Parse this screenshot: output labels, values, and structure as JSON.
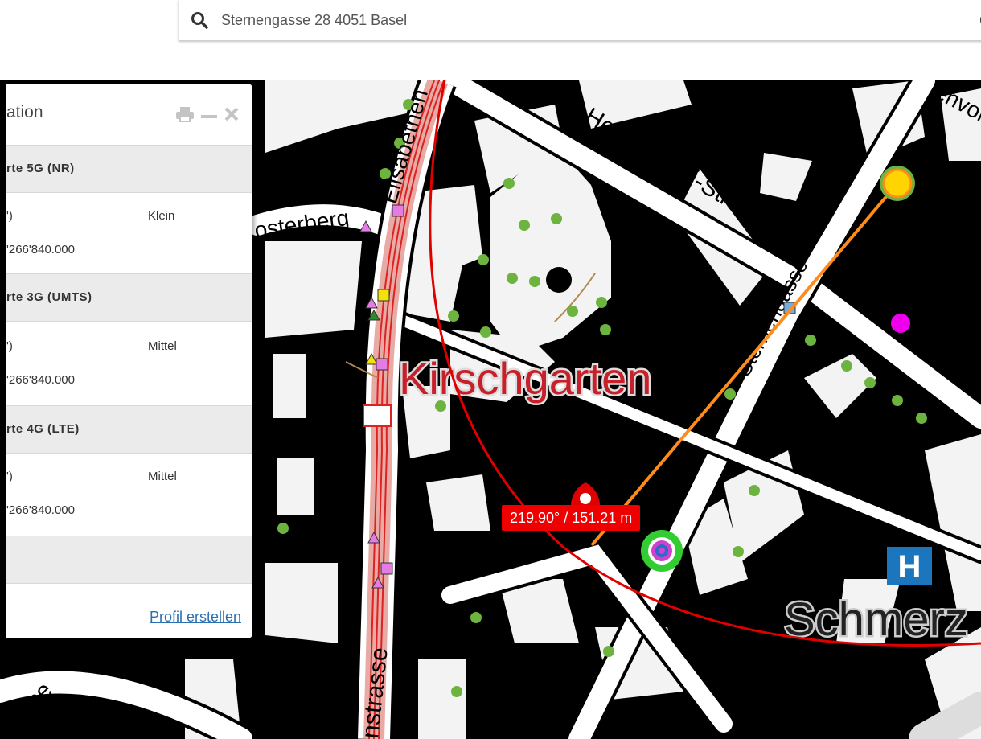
{
  "search": {
    "value": "Sternengasse 28 4051 Basel",
    "icon": "search-icon"
  },
  "panel": {
    "title": "ation",
    "sections": [
      {
        "header": "rte 5G (NR)",
        "line1_left": "')",
        "line1_right": "Klein",
        "line2": "'266'840.000"
      },
      {
        "header": "rte 3G (UMTS)",
        "line1_left": "')",
        "line1_right": "Mittel",
        "line2": "'266'840.000"
      },
      {
        "header": "rte 4G (LTE)",
        "line1_left": "')",
        "line1_right": "Mittel",
        "line2": "'266'840.000"
      }
    ],
    "profile_link": "Profil erstellen"
  },
  "measure": {
    "label": "219.90° / 151.21 m"
  },
  "map_labels": {
    "kirschgarten": "Kirschgarten",
    "henric": "Henric-Petri-Strasse",
    "elisabethen": "Elisabethen",
    "klosterberg": "osterberg",
    "sternengasse": "Sternengasse",
    "strasse_bottom": "nstrasse",
    "gasse_left": "asse",
    "schmerz": "Schmerz",
    "envor": "envor",
    "hospital_letter": "H"
  },
  "colors": {
    "measure_red": "#e00000",
    "bearing_orange": "#ff8c1a",
    "link_blue": "#2a6fb0"
  }
}
